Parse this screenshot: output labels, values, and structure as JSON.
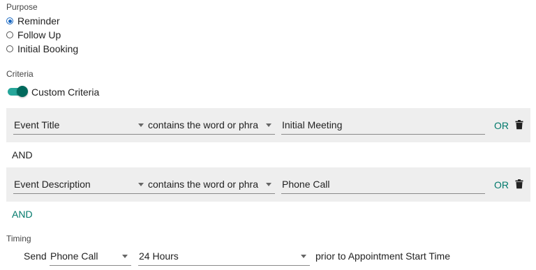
{
  "purpose": {
    "label": "Purpose",
    "options": [
      {
        "label": "Reminder",
        "checked": true
      },
      {
        "label": "Follow Up",
        "checked": false
      },
      {
        "label": "Initial Booking",
        "checked": false
      }
    ]
  },
  "criteria": {
    "label": "Criteria",
    "custom_toggle": {
      "label": "Custom Criteria",
      "on": true
    },
    "rows": [
      {
        "field": "Event Title",
        "operator": "contains the word or phra",
        "value": "Initial Meeting",
        "or_label": "OR"
      },
      {
        "field": "Event Description",
        "operator": "contains the word or phra",
        "value": "Phone Call",
        "or_label": "OR"
      }
    ],
    "and_static": "AND",
    "and_add": "AND"
  },
  "timing": {
    "label": "Timing",
    "send_label": "Send",
    "method": "Phone Call",
    "offset": "24 Hours",
    "suffix": "prior to Appointment Start Time"
  },
  "colors": {
    "accent": "#00796b",
    "radio": "#1565c0",
    "toggle_track": "#26a69a",
    "row_bg": "#eeeeee"
  },
  "icons": {
    "delete": "trash-icon",
    "dropdown": "caret-down-icon"
  }
}
